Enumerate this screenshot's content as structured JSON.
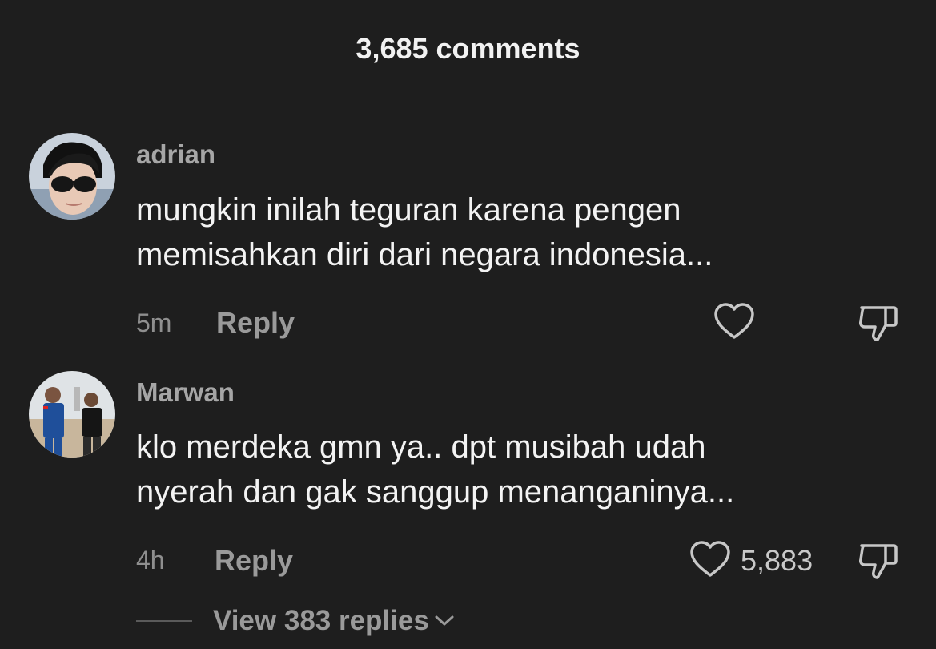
{
  "header": {
    "title": "3,685 comments"
  },
  "comments": [
    {
      "username": "adrian",
      "text_line1": "mungkin inilah teguran karena pengen",
      "text_line2": "memisahkan diri dari negara indonesia...",
      "time": "5m",
      "reply_label": "Reply",
      "like_count": "",
      "avatar_icon": "avatar-man-sunglasses"
    },
    {
      "username": "Marwan",
      "text_line1": "klo merdeka gmn ya.. dpt musibah udah",
      "text_line2": "nyerah dan gak sanggup menanganinya...",
      "time": "4h",
      "reply_label": "Reply",
      "like_count": "5,883",
      "avatar_icon": "avatar-two-men-outdoors"
    }
  ],
  "view_replies": {
    "label": "View 383 replies"
  },
  "icons": {
    "like": "heart-icon",
    "dislike": "thumbs-down-icon",
    "expand": "chevron-down-icon"
  }
}
